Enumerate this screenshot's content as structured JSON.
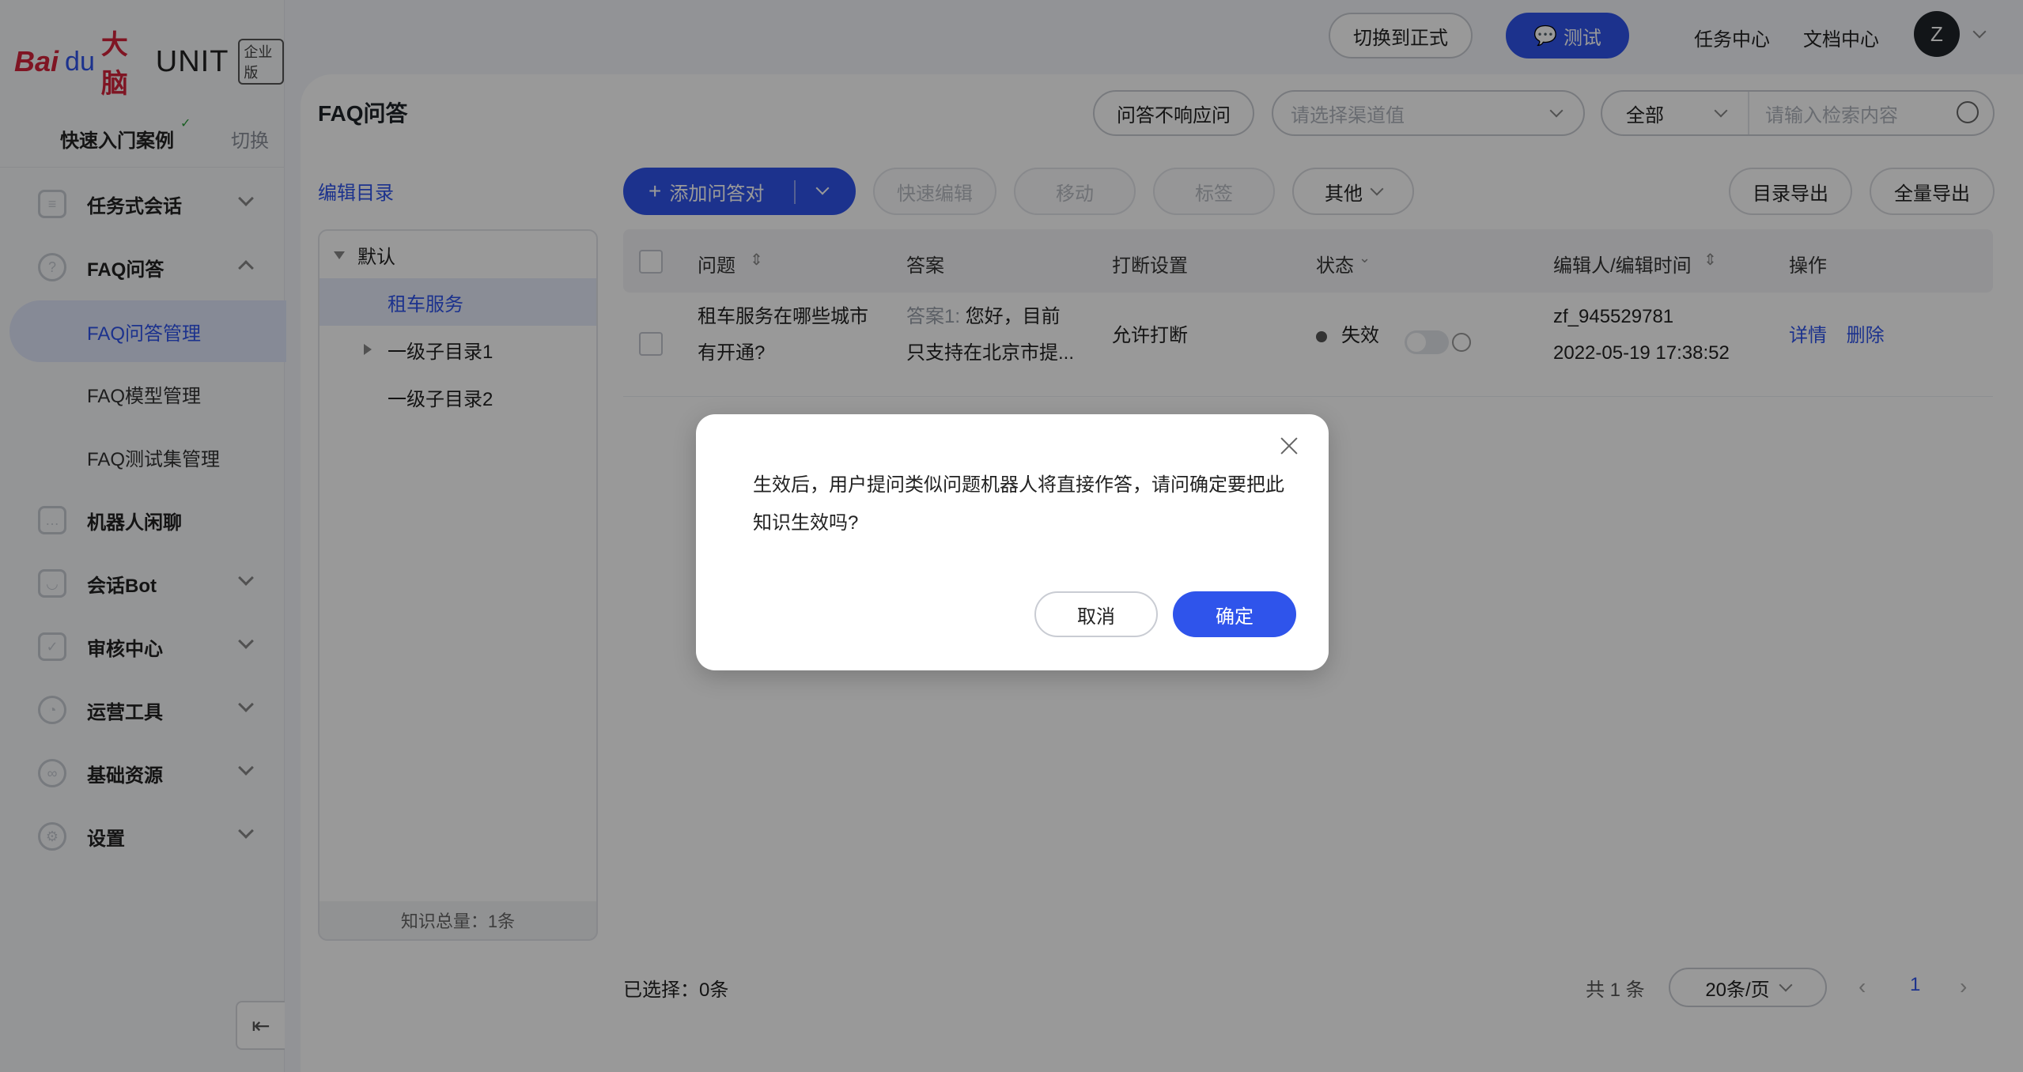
{
  "brand": {
    "logo_bai": "Bai",
    "logo_paw": "du",
    "logo_brain": "大脑",
    "logo_unit": "UNIT",
    "edition": "企业版"
  },
  "sidebar": {
    "quick_start": "快速入门案例",
    "switch": "切换",
    "items": [
      {
        "label": "任务式会话",
        "icon": "task-flow-icon",
        "expandable": true
      },
      {
        "label": "FAQ问答",
        "icon": "faq-icon",
        "expanded": true
      },
      {
        "label": "FAQ问答管理",
        "sub": true,
        "active": true
      },
      {
        "label": "FAQ模型管理",
        "sub": true
      },
      {
        "label": "FAQ测试集管理",
        "sub": true
      },
      {
        "label": "机器人闲聊",
        "icon": "chat-bubble-icon"
      },
      {
        "label": "会话Bot",
        "icon": "bot-icon",
        "expandable": true
      },
      {
        "label": "审核中心",
        "icon": "shield-check-icon",
        "expandable": true
      },
      {
        "label": "运营工具",
        "icon": "pie-chart-icon",
        "expandable": true
      },
      {
        "label": "基础资源",
        "icon": "resources-icon",
        "expandable": true
      },
      {
        "label": "设置",
        "icon": "settings-icon",
        "expandable": true
      }
    ]
  },
  "topbar": {
    "switch_formal": "切换到正式",
    "test": "测试",
    "task_center": "任务中心",
    "doc_center": "文档中心",
    "avatar_initial": "Z"
  },
  "page": {
    "title": "FAQ问答",
    "no_response_btn": "问答不响应问",
    "channel_placeholder": "请选择渠道值",
    "scope_select": "全部",
    "search_placeholder": "请输入检索内容"
  },
  "directory": {
    "edit_label": "编辑目录",
    "root": "默认",
    "nodes": [
      "租车服务",
      "一级子目录1",
      "一级子目录2"
    ],
    "total": "知识总量：1条"
  },
  "toolbar": {
    "add_qa": "添加问答对",
    "quick_edit": "快速编辑",
    "move": "移动",
    "tag": "标签",
    "other": "其他",
    "export_dir": "目录导出",
    "export_all": "全量导出"
  },
  "table": {
    "headers": [
      "问题",
      "答案",
      "打断设置",
      "状态",
      "编辑人/编辑时间",
      "操作"
    ],
    "rows": [
      {
        "question_line1": "租车服务在哪些城市",
        "question_line2": "有开通?",
        "answer_prefix": "答案1:",
        "answer_line1": "您好，目前",
        "answer_line2": "只支持在北京市提...",
        "interrupt": "允许打断",
        "status": "失效",
        "editor": "zf_945529781",
        "edit_time": "2022-05-19 17:38:52",
        "action_detail": "详情",
        "action_delete": "删除"
      }
    ]
  },
  "footer": {
    "selected": "已选择：0条",
    "total": "共 1 条",
    "page_size": "20条/页",
    "current_page": "1"
  },
  "modal": {
    "message": "生效后，用户提问类似问题机器人将直接作答，请问确定要把此知识生效吗?",
    "cancel": "取消",
    "confirm": "确定"
  }
}
